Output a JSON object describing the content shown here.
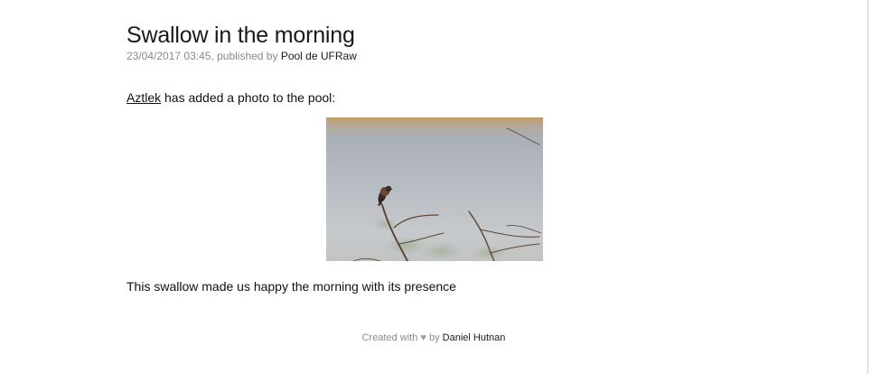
{
  "post": {
    "title": "Swallow in the morning",
    "meta_date": "23/04/2017 03:45, published by ",
    "meta_publisher": "Pool de UFRaw",
    "intro_link": "Aztlek",
    "intro_text": " has added a photo to the pool:",
    "caption": "This swallow made us happy the morning with its presence"
  },
  "footer": {
    "created_with": "Created with ",
    "heart": "♥",
    "by": " by ",
    "author": "Daniel Hutnan"
  }
}
